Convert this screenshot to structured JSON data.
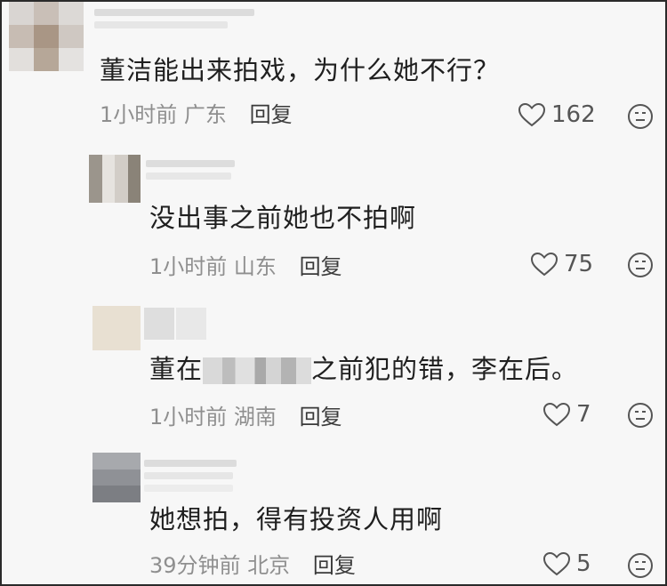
{
  "comments": [
    {
      "text": "董洁能出来拍戏，为什么她不行？",
      "time": "1小时前",
      "location": "广东",
      "reply_label": "回复",
      "likes": "162"
    },
    {
      "text": "没出事之前她也不拍啊",
      "time": "1小时前",
      "location": "山东",
      "reply_label": "回复",
      "likes": "75"
    },
    {
      "text_before": "董在",
      "text_after": "之前犯的错，李在后。",
      "time": "1小时前",
      "location": "湖南",
      "reply_label": "回复",
      "likes": "7"
    },
    {
      "text": "她想拍，得有投资人用啊",
      "time": "39分钟前",
      "location": "北京",
      "reply_label": "回复",
      "likes": "5"
    }
  ],
  "icons": {
    "like": "heart-outline-icon",
    "more": "meh-face-icon"
  },
  "colors": {
    "background": "#f7f7f7",
    "text": "#1f1f1f",
    "meta": "#8f8f8f",
    "border": "#2a2a2a"
  }
}
